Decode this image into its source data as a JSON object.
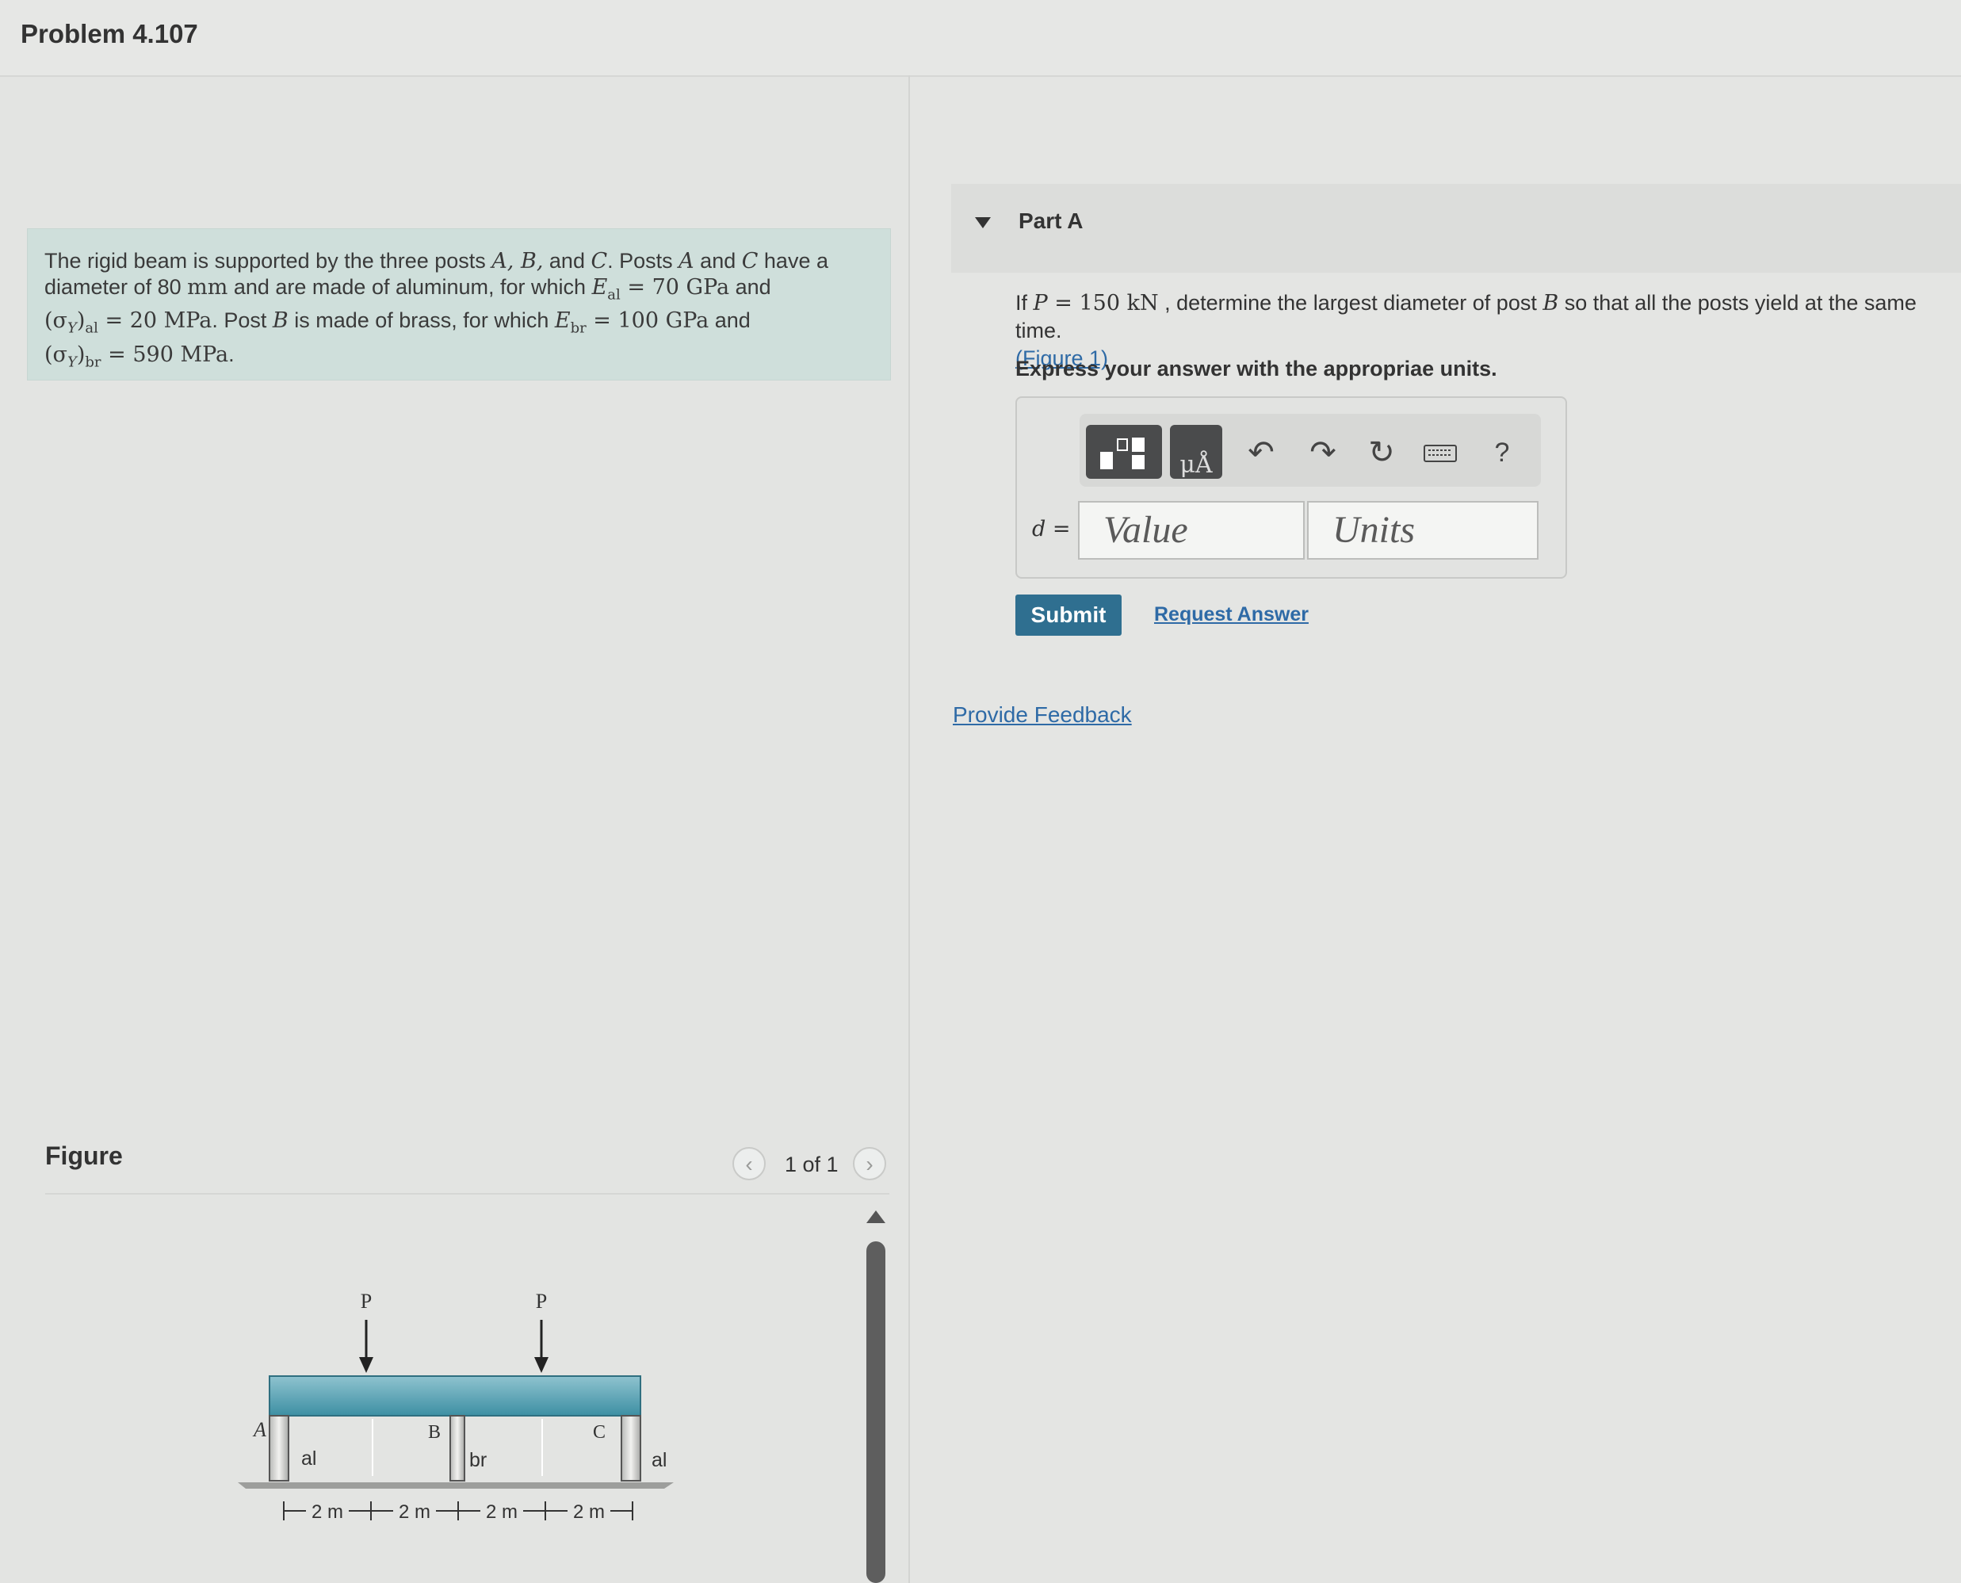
{
  "header": {
    "title": "Problem 4.107"
  },
  "problem": {
    "line1_a": "The rigid beam is supported by the three posts ",
    "line1_math": "A, B,",
    "line1_b": " and ",
    "line1_math2": "C",
    "line1_c": ". Posts ",
    "line1_math3": "A",
    "line1_d": " and ",
    "line1_math4": "C",
    "line1_e": " have a",
    "line2_a": "diameter of 80 ",
    "line2_unit": "mm",
    "line2_b": " and are made of aluminum, for which ",
    "line2_E": "E",
    "line2_sub": "al",
    "line2_eq": " = 70 GPa",
    "line2_c": " and",
    "line3_sigma": "(σ",
    "line3_Y": "Y",
    "line3_close": ")",
    "line3_sub": "al",
    "line3_eq": " = 20 MPa",
    "line3_a": ". Post ",
    "line3_B": "B",
    "line3_b": " is made of brass, for which ",
    "line3_E": "E",
    "line3_sub2": "br",
    "line3_eq2": " = 100 GPa",
    "line3_c": " and",
    "line4_sigma": "(σ",
    "line4_Y": "Y",
    "line4_close": ")",
    "line4_sub": "br",
    "line4_eq": " = 590 MPa",
    "line4_end": "."
  },
  "figure": {
    "label": "Figure",
    "pager": "1 of 1",
    "prev_icon": "chevron-left-icon",
    "next_icon": "chevron-right-icon",
    "labels": {
      "P1": "P",
      "P2": "P",
      "A": "A",
      "B": "B",
      "C": "C",
      "al_left": "al",
      "br": "br",
      "al_right": "al",
      "dim1": "2 m",
      "dim2": "2 m",
      "dim3": "2 m",
      "dim4": "2 m"
    }
  },
  "part_a": {
    "title": "Part A",
    "question_a": "If ",
    "question_P": "P",
    "question_eq": " = 150 kN",
    "question_b": " , determine the largest diameter of post ",
    "question_B": "B",
    "question_c": " so that all the posts yield at the same time.",
    "figure_link": "(Figure 1)",
    "express": "Express your answer with the appropriae units.",
    "variable": "d =",
    "value_placeholder": "Value",
    "units_placeholder": "Units",
    "toolbar_icons": [
      "template-icon",
      "units-icon",
      "undo-icon",
      "redo-icon",
      "reset-icon",
      "keyboard-icon",
      "help-icon"
    ],
    "help_label": "?",
    "submit": "Submit",
    "request_answer": "Request Answer"
  },
  "feedback": {
    "label": "Provide Feedback"
  }
}
